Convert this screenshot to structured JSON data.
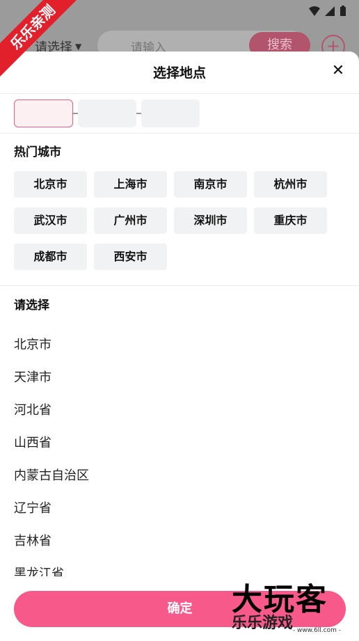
{
  "background": {
    "region_label": "请选择",
    "search_placeholder": "请输入",
    "search_button": "搜索",
    "ribbon_text": "乐乐亲测"
  },
  "sheet": {
    "title": "选择地点",
    "close_icon": "close-icon",
    "hot_cities_title": "热门城市",
    "hot_cities": [
      "北京市",
      "上海市",
      "南京市",
      "杭州市",
      "武汉市",
      "广州市",
      "深圳市",
      "重庆市",
      "成都市",
      "西安市"
    ],
    "list_title": "请选择",
    "provinces": [
      "北京市",
      "天津市",
      "河北省",
      "山西省",
      "内蒙古自治区",
      "辽宁省",
      "吉林省",
      "黑龙江省"
    ],
    "confirm_label": "确定"
  },
  "watermark": {
    "line1": "大玩客",
    "line2": "乐乐游戏",
    "url": "- www.6ll.com -"
  },
  "colors": {
    "accent": "#f7598b",
    "selected_border": "#f05a84",
    "chip_bg": "#f1f2f4"
  }
}
